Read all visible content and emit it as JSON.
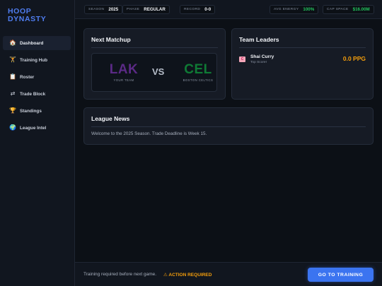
{
  "app": {
    "title_line1": "HOOP",
    "title_line2": "DYNASTY"
  },
  "sidebar": {
    "items": [
      {
        "label": "Dashboard",
        "icon": "home-icon",
        "glyph": "🏠",
        "active": true
      },
      {
        "label": "Training Hub",
        "icon": "weightlifter-icon",
        "glyph": "🏋",
        "active": false
      },
      {
        "label": "Roster",
        "icon": "clipboard-icon",
        "glyph": "📋",
        "active": false
      },
      {
        "label": "Trade Block",
        "icon": "swap-arrows-icon",
        "glyph": "⇄",
        "active": false
      },
      {
        "label": "Standings",
        "icon": "trophy-icon",
        "glyph": "🏆",
        "active": false
      },
      {
        "label": "League Intel",
        "icon": "globe-icon",
        "glyph": "🌍",
        "active": false
      }
    ]
  },
  "topbar": {
    "season_label": "SEASON",
    "season_value": "2025",
    "phase_label": "PHASE",
    "phase_value": "REGULAR",
    "record_label": "RECORD",
    "record_value": "0-0",
    "energy_label": "AVG ENERGY",
    "energy_value": "100%",
    "cap_label": "CAP SPACE",
    "cap_value": "$16.00M"
  },
  "matchup": {
    "title": "Next Matchup",
    "home_abbr": "LAK",
    "home_sub": "YOUR TEAM",
    "vs": "VS",
    "away_abbr": "CEL",
    "away_sub": "BOSTON CELTICS"
  },
  "leaders": {
    "title": "Team Leaders",
    "badge": "C",
    "name": "Shai Curry",
    "role": "Top Scorer",
    "stat": "0.0 PPG"
  },
  "news": {
    "title": "League News",
    "text": "Welcome to the 2025 Season. Trade Deadline is Week 15."
  },
  "bottombar": {
    "message": "Training required before next game.",
    "warning": "⚠ ACTION REQUIRED",
    "cta_label": "GO TO TRAINING"
  },
  "colors": {
    "accent": "#3b74f0",
    "lak": "#5b2a86",
    "cel": "#0f7a35",
    "warning": "#f59e0b",
    "success": "#22c55e"
  }
}
